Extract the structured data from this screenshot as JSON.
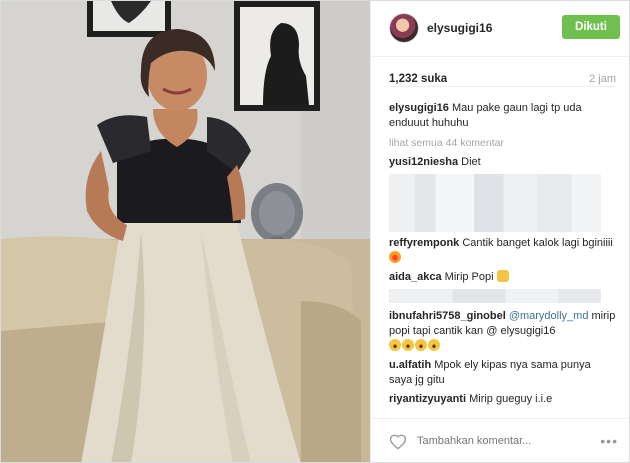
{
  "header": {
    "username": "elysugigi16",
    "follow_label": "Dikuti"
  },
  "stats": {
    "likes": "1,232 suka",
    "time": "2 jam"
  },
  "caption": {
    "user": "elysugigi16",
    "text": "Mau pake gaun lagi tp uda enduuut huhuhu"
  },
  "view_all": "lihat semua 44 komentar",
  "comments": [
    {
      "user": "yusi12niesha",
      "text": "Diet"
    },
    {
      "user": "reffyremponk",
      "text": "Cantik banget kalok lagi bginiiii"
    },
    {
      "user": "aida_akca",
      "text": "Mirip Popi"
    },
    {
      "user": "ibnufahri5758_ginobel",
      "mention": "@marydolly_md",
      "text": "mirip popi tapi cantik kan @ elysugigi16"
    },
    {
      "user": "u.alfatih",
      "text": "Mpok ely kipas nya sama punya saya jg gitu"
    },
    {
      "user": "riyantizyuyanti",
      "text": "Mirip gueguy i.i.e"
    }
  ],
  "footer": {
    "add_comment_placeholder": "Tambahkan komentar...",
    "more": "•••"
  },
  "icons": {
    "like": "heart-outline-icon",
    "more": "more-options-icon"
  },
  "colors": {
    "follow_button": "#70c050",
    "mention": "#3f729b",
    "muted": "#a5a5a5"
  }
}
